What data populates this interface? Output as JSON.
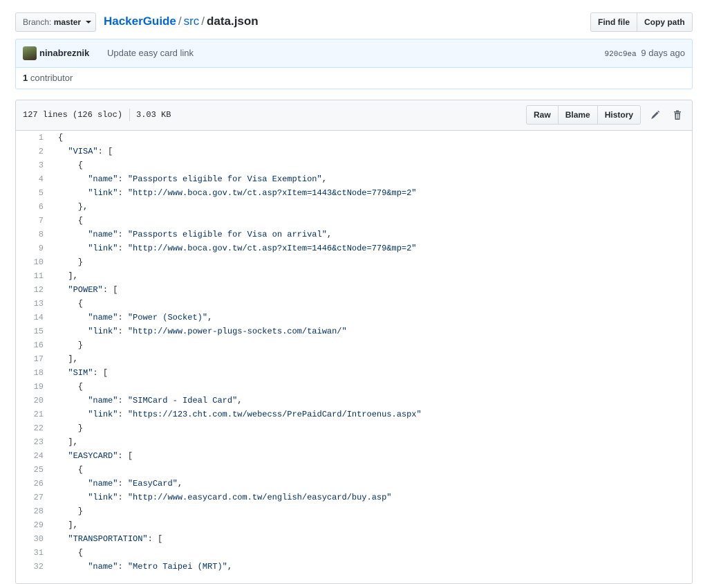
{
  "branch": {
    "label": "Branch:",
    "name": "master"
  },
  "breadcrumb": {
    "repo": "HackerGuide",
    "dir": "src",
    "sep": "/",
    "file": "data.json"
  },
  "toolbar": {
    "find_file": "Find file",
    "copy_path": "Copy path"
  },
  "commit": {
    "author": "ninabreznik",
    "message": "Update easy card link",
    "sha": "920c9ea",
    "time": "9 days ago"
  },
  "contributors": {
    "count": "1",
    "label": "contributor"
  },
  "file": {
    "lines_info": "127 lines (126 sloc)",
    "size": "3.03 KB",
    "raw": "Raw",
    "blame": "Blame",
    "history": "History"
  },
  "icons": {
    "edit": "pencil-icon",
    "delete": "trashcan-icon"
  },
  "colors": {
    "link": "#0366d6",
    "string": "#032f62",
    "line_number": "#959da5"
  },
  "code_lines": [
    "{",
    "  \"VISA\": [",
    "    {",
    "      \"name\": \"Passports eligible for Visa Exemption\",",
    "      \"link\": \"http://www.boca.gov.tw/ct.asp?xItem=1443&ctNode=779&mp=2\"",
    "    },",
    "    {",
    "      \"name\": \"Passports eligible for Visa on arrival\",",
    "      \"link\": \"http://www.boca.gov.tw/ct.asp?xItem=1446&ctNode=779&mp=2\"",
    "    }",
    "  ],",
    "  \"POWER\": [",
    "    {",
    "      \"name\": \"Power (Socket)\",",
    "      \"link\": \"http://www.power-plugs-sockets.com/taiwan/\"",
    "    }",
    "  ],",
    "  \"SIM\": [",
    "    {",
    "      \"name\": \"SIMCard - Ideal Card\",",
    "      \"link\": \"https://123.cht.com.tw/webecss/PrePaidCard/Introenus.aspx\"",
    "    }",
    "  ],",
    "  \"EASYCARD\": [",
    "    {",
    "      \"name\": \"EasyCard\",",
    "      \"link\": \"http://www.easycard.com.tw/english/easycard/buy.asp\"",
    "    }",
    "  ],",
    "  \"TRANSPORTATION\": [",
    "    {",
    "      \"name\": \"Metro Taipei (MRT)\","
  ]
}
